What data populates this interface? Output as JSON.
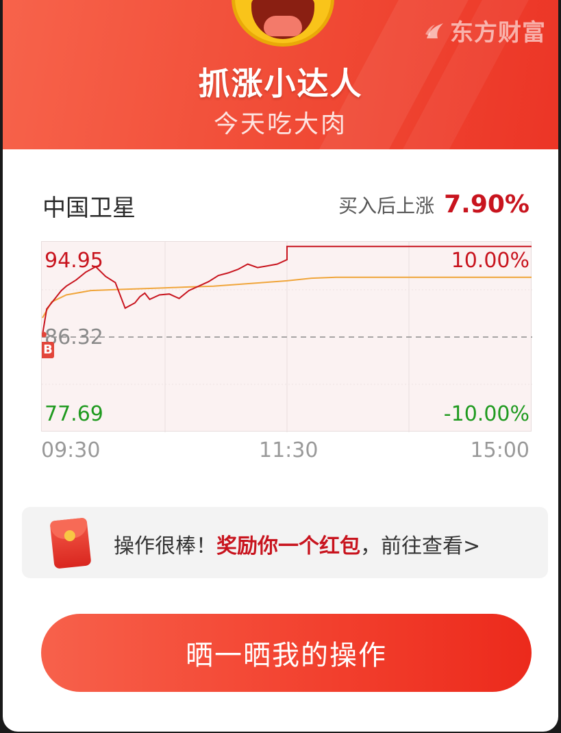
{
  "header": {
    "brand": "东方财富",
    "title": "抓涨小达人",
    "subtitle": "今天吃大肉"
  },
  "stock": {
    "name": "中国卫星",
    "gain_label": "买入后上涨",
    "gain_value": "7.90%"
  },
  "chart_data": {
    "type": "line",
    "y_high_label": "94.95",
    "y_mid_label": "86.32",
    "y_low_label": "77.69",
    "pct_high_label": "10.00%",
    "pct_low_label": "-10.00%",
    "time_labels": [
      "09:30",
      "11:30",
      "15:00"
    ],
    "buy_marker": "B",
    "ylim": [
      77.69,
      94.95
    ],
    "series": [
      {
        "role": "price",
        "x": [
          0,
          0.01,
          0.02,
          0.04,
          0.05,
          0.07,
          0.09,
          0.11,
          0.13,
          0.15,
          0.17,
          0.19,
          0.2,
          0.21,
          0.22,
          0.24,
          0.26,
          0.28,
          0.3,
          0.32,
          0.34,
          0.36,
          0.38,
          0.4,
          0.42,
          0.44,
          0.46,
          0.48,
          0.5,
          0.5,
          1.0
        ],
        "values": [
          86.6,
          89.5,
          90.2,
          91.6,
          92.1,
          92.8,
          93.7,
          94.3,
          93.2,
          92.5,
          89.6,
          90.2,
          90.9,
          91.3,
          90.6,
          91.1,
          91.2,
          90.7,
          91.6,
          92.1,
          92.6,
          93.3,
          93.6,
          94.0,
          94.6,
          94.2,
          94.4,
          94.6,
          95.1,
          96.6,
          96.6
        ]
      },
      {
        "role": "average",
        "x": [
          0,
          0.02,
          0.05,
          0.1,
          0.15,
          0.2,
          0.25,
          0.3,
          0.35,
          0.4,
          0.45,
          0.5,
          0.55,
          0.6,
          0.7,
          0.8,
          0.9,
          1.0
        ],
        "values": [
          88.5,
          90.3,
          91.1,
          91.6,
          91.7,
          91.8,
          91.9,
          92.0,
          92.1,
          92.3,
          92.5,
          92.7,
          93.0,
          93.1,
          93.1,
          93.1,
          93.1,
          93.1
        ]
      }
    ]
  },
  "reward": {
    "text_a": "操作很棒！",
    "text_b": "奖励你一个红包",
    "text_c": "，前往查看>"
  },
  "share_button": "晒一晒我的操作",
  "colors": {
    "accent": "#f04a35",
    "up": "#c8141e",
    "down": "#1f9a1f",
    "avg_line": "#f0a53a"
  }
}
